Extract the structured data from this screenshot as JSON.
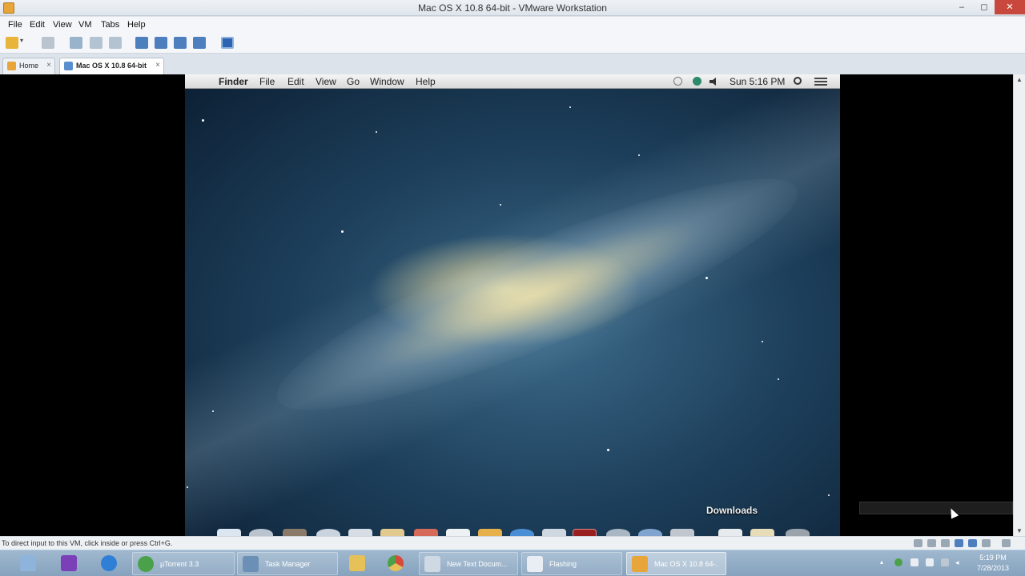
{
  "window": {
    "title": "Mac OS X 10.8 64-bit - VMware Workstation"
  },
  "window_controls": {
    "minimize": "‒",
    "maximize": "◻",
    "close": "✕"
  },
  "menu": [
    "File",
    "Edit",
    "View",
    "VM",
    "Tabs",
    "Help"
  ],
  "tabs": [
    {
      "label": "Home",
      "close": "×"
    },
    {
      "label": "Mac OS X 10.8 64-bit",
      "close": "×"
    }
  ],
  "guest": {
    "menubar": {
      "apple": "",
      "app": "Finder",
      "items": [
        "File",
        "Edit",
        "View",
        "Go",
        "Window",
        "Help"
      ],
      "clock": "Sun 5:16 PM"
    },
    "dock_label": "Downloads"
  },
  "statusbar": {
    "message": "To direct input to this VM, click inside or press Ctrl+G."
  },
  "taskbar": {
    "buttons": [
      {
        "label": "",
        "color": "#8fb4dc"
      },
      {
        "label": "",
        "color": "#7b3fb8"
      },
      {
        "label": "",
        "color": "#2f7fd6"
      },
      {
        "label": "µTorrent 3.3",
        "color": "#4aa14a"
      },
      {
        "label": "Task Manager",
        "color": "#6c8fb5"
      },
      {
        "label": "",
        "color": "#e6c15a"
      },
      {
        "label": "",
        "color": "#d64a3a"
      },
      {
        "label": "New Text Docum...",
        "color": "#cfd9e3"
      },
      {
        "label": "Flashing",
        "color": "#e8eef4"
      },
      {
        "label": "Mac OS X 10.8 64-...",
        "color": "#e7a53a"
      }
    ],
    "clock_time": "5:19 PM",
    "clock_date": "7/28/2013"
  }
}
